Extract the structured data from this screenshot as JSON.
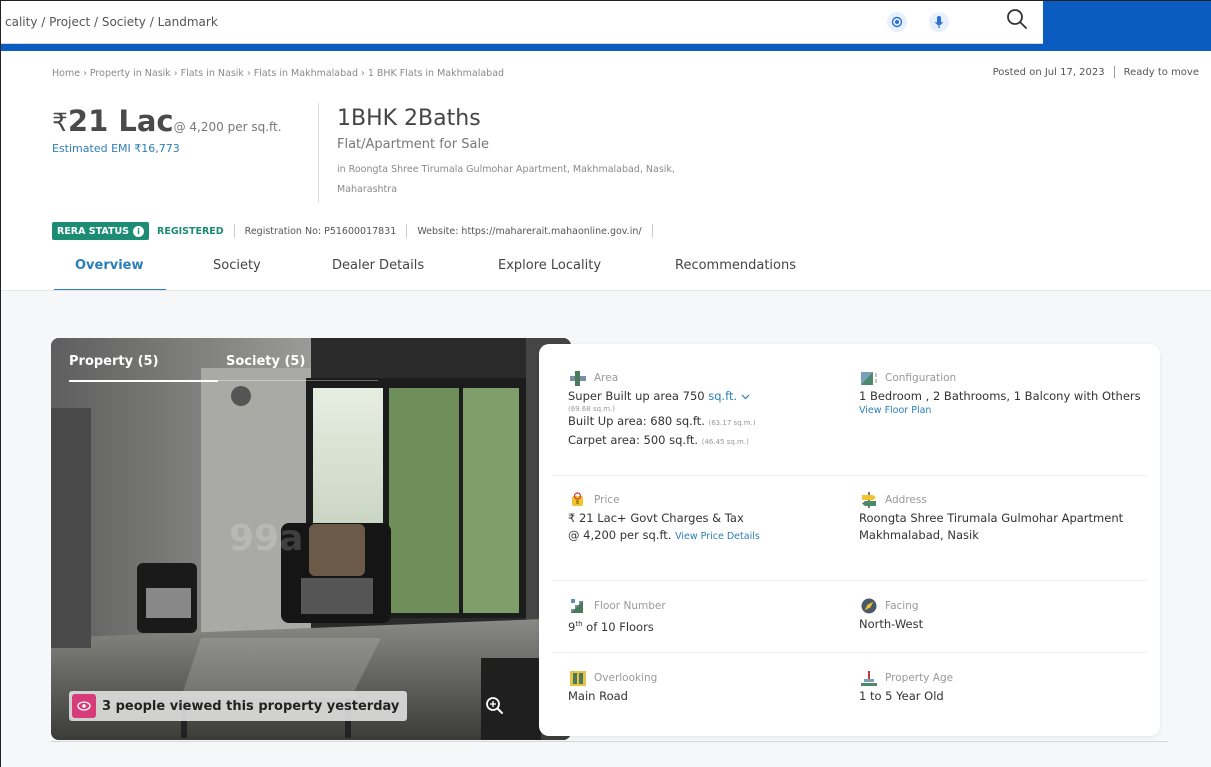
{
  "search": {
    "placeholder": "cality / Project / Society / Landmark",
    "icons": [
      "location-icon",
      "mic-icon",
      "search-icon"
    ],
    "accent": "#0b5cc1"
  },
  "breadcrumb": [
    "Home",
    "Property in Nasik",
    "Flats in Nasik",
    "Flats in Makhmalabad",
    "1 BHK Flats in Makhmalabad"
  ],
  "breadcrumb_sep": "›",
  "posted": {
    "date": "Posted on Jul 17, 2023",
    "status": "Ready to move"
  },
  "price": {
    "currency": "₹",
    "amount": "21 Lac",
    "per_sqft": "@ 4,200 per sq.ft.",
    "emi": "Estimated EMI ₹16,773"
  },
  "listing": {
    "title": "1BHK 2Baths",
    "subtitle": "Flat/Apartment for Sale",
    "address": "in Roongta Shree Tirumala Gulmohar Apartment, Makhmalabad, Nasik, Maharashtra"
  },
  "rera": {
    "badge": "RERA STATUS",
    "status": "REGISTERED",
    "registration": "Registration No: P51600017831",
    "website": "Website: https://maharerait.mahaonline.gov.in/",
    "color": "#1c8c74"
  },
  "tabs": [
    "Overview",
    "Society",
    "Dealer Details",
    "Explore Locality",
    "Recommendations"
  ],
  "photo": {
    "tab_property": "Property (5)",
    "tab_society": "Society (5)",
    "viewed": "3 people viewed this property yesterday",
    "watermark": "99a"
  },
  "details": {
    "area": {
      "label": "Area",
      "super_prefix": "Super Built up area 750",
      "unit": "sq.ft.",
      "super_sqm": "(69.68 sq.m.)",
      "built_up": "Built Up area: 680 sq.ft.",
      "built_up_sqm": "(63.17 sq.m.)",
      "carpet": "Carpet area: 500 sq.ft.",
      "carpet_sqm": "(46.45 sq.m.)"
    },
    "configuration": {
      "label": "Configuration",
      "value": "1 Bedroom , 2 Bathrooms, 1 Balcony with Others",
      "link": "View Floor Plan"
    },
    "price": {
      "label": "Price",
      "value": "₹ 21 Lac+ Govt Charges & Tax",
      "per": "@ 4,200 per sq.ft.",
      "link": "View Price Details"
    },
    "address": {
      "label": "Address",
      "line1": "Roongta Shree Tirumala Gulmohar Apartment",
      "line2": "Makhmalabad, Nasik"
    },
    "floor": {
      "label": "Floor Number",
      "num": "9",
      "sup": "th",
      "rest": "of 10 Floors"
    },
    "facing": {
      "label": "Facing",
      "value": "North-West"
    },
    "overlooking": {
      "label": "Overlooking",
      "value": "Main Road"
    },
    "age": {
      "label": "Property Age",
      "value": "1 to 5 Year Old"
    }
  }
}
